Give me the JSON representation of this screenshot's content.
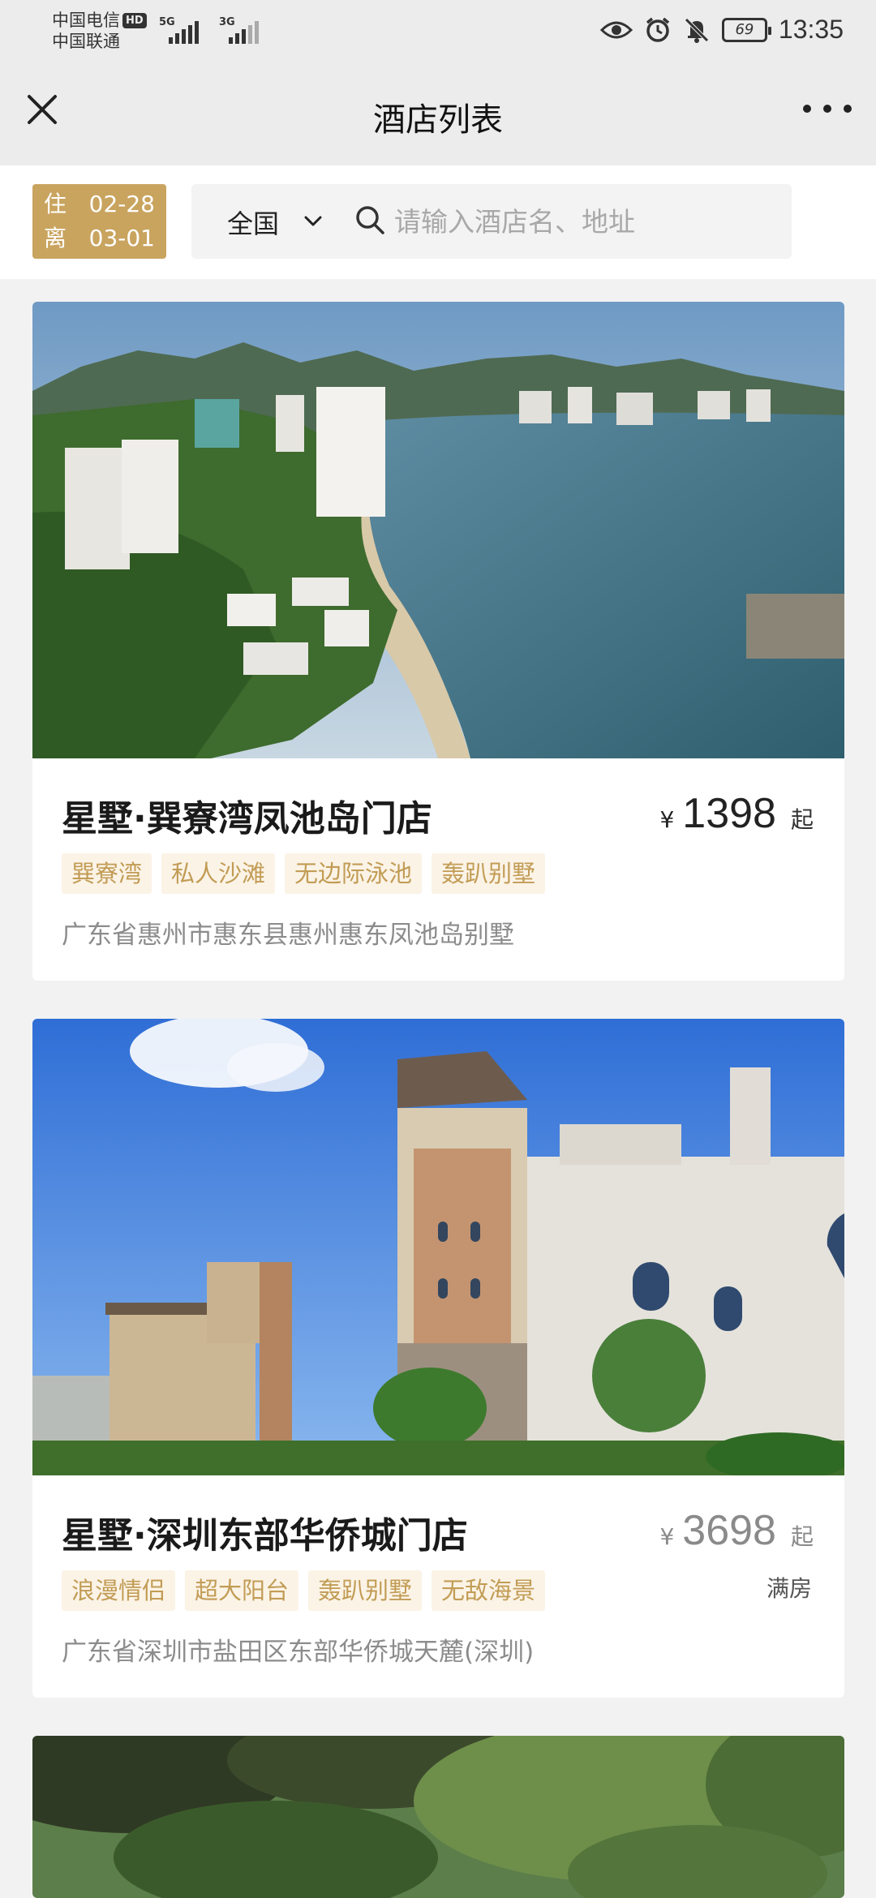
{
  "status_bar": {
    "carrier_1": "中国电信",
    "carrier_1_badge": "HD",
    "carrier_2": "中国联通",
    "signal_1_label": "5G",
    "signal_2_label": "3G",
    "battery": "69",
    "time": "13:35"
  },
  "nav": {
    "title": "酒店列表",
    "close_icon": "close-icon",
    "more_icon": "more-icon"
  },
  "filter": {
    "checkin_label": "住",
    "checkin_date": "02-28",
    "checkout_label": "离",
    "checkout_date": "03-01",
    "region": "全国",
    "search_placeholder": "请输入酒店名、地址",
    "accent_color": "#c9a45f"
  },
  "hotels": [
    {
      "name": "星墅·巽寮湾凤池岛门店",
      "currency": "¥",
      "price": "1398",
      "price_suffix": "起",
      "status": "",
      "tags": [
        "巽寮湾",
        "私人沙滩",
        "无边际泳池",
        "轰趴别墅"
      ],
      "address": "广东省惠州市惠东县惠州惠东凤池岛别墅"
    },
    {
      "name": "星墅·深圳东部华侨城门店",
      "currency": "¥",
      "price": "3698",
      "price_suffix": "起",
      "status": "满房",
      "tags": [
        "浪漫情侣",
        "超大阳台",
        "轰趴别墅",
        "无敌海景"
      ],
      "address": "广东省深圳市盐田区东部华侨城天麓(深圳)"
    }
  ]
}
